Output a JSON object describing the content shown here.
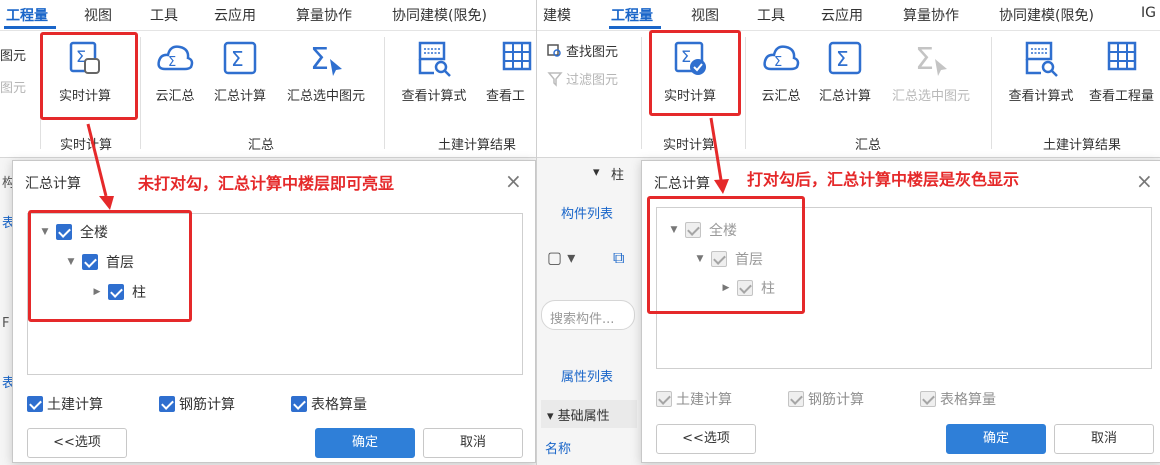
{
  "colors": {
    "accent": "#1a66c9",
    "highlight_red": "#e5292a",
    "checkbox_blue": "#2f6fcf",
    "primary_button": "#2f7fd8"
  },
  "left": {
    "menu": [
      "工程量",
      "视图",
      "工具",
      "云应用",
      "算量协作",
      "协同建模(限免)"
    ],
    "ribbon": {
      "side_items": [
        "图元",
        "图元"
      ],
      "realtime": {
        "button_label": "实时计算",
        "group_label": "实时计算",
        "icon": "realtime-calc-icon"
      },
      "summary_buttons": [
        {
          "label": "云汇总",
          "icon": "cloud-sum-icon"
        },
        {
          "label": "汇总计算",
          "icon": "sigma-icon"
        },
        {
          "label": "汇总选中图元",
          "icon": "sigma-cursor-icon"
        }
      ],
      "summary_group_label": "汇总",
      "result_buttons": [
        {
          "label": "查看计算式",
          "icon": "view-formula-icon"
        },
        {
          "label": "查看工"
        }
      ],
      "result_group_label": "土建计算结果"
    },
    "side_strip": [
      "构",
      "表",
      "F",
      "表"
    ],
    "dialog": {
      "title": "汇总计算",
      "close": "×",
      "tree": [
        {
          "label": "全楼",
          "checked": true
        },
        {
          "label": "首层",
          "checked": true
        },
        {
          "label": "柱",
          "checked": true
        }
      ],
      "options": [
        "土建计算",
        "钢筋计算",
        "表格算量"
      ],
      "more_button": "<<选项",
      "ok_button": "确定",
      "cancel_button": "取消"
    },
    "annotation": "未打对勾，汇总计算中楼层即可亮显"
  },
  "right": {
    "menu": [
      "建模",
      "工程量",
      "视图",
      "工具",
      "云应用",
      "算量协作",
      "协同建模(限免)",
      "IG"
    ],
    "ribbon": {
      "side_items": [
        "查找图元",
        "过滤图元"
      ],
      "realtime": {
        "button_label": "实时计算",
        "group_label": "实时计算",
        "icon": "realtime-calc-checked-icon"
      },
      "summary_buttons": [
        {
          "label": "云汇总",
          "icon": "cloud-sum-icon"
        },
        {
          "label": "汇总计算",
          "icon": "sigma-icon"
        },
        {
          "label": "汇总选中图元",
          "icon": "sigma-cursor-icon"
        }
      ],
      "summary_group_label": "汇总",
      "result_buttons": [
        {
          "label": "查看计算式",
          "icon": "view-formula-icon"
        },
        {
          "label": "查看工程量",
          "icon": "view-quantity-icon"
        }
      ],
      "result_group_label": "土建计算结果"
    },
    "side_panel": {
      "floor_value": "柱",
      "component_list": "构件列表",
      "search_placeholder": "搜索构件...",
      "property_list": "属性列表",
      "base_props": "基础属性",
      "name_label": "名称"
    },
    "dialog": {
      "title": "汇总计算",
      "close": "×",
      "tree": [
        {
          "label": "全楼",
          "checked": true
        },
        {
          "label": "首层",
          "checked": true
        },
        {
          "label": "柱",
          "checked": true
        }
      ],
      "options": [
        "土建计算",
        "钢筋计算",
        "表格算量"
      ],
      "more_button": "<<选项",
      "ok_button": "确定",
      "cancel_button": "取消"
    },
    "annotation": "打对勾后，汇总计算中楼层是灰色显示"
  }
}
